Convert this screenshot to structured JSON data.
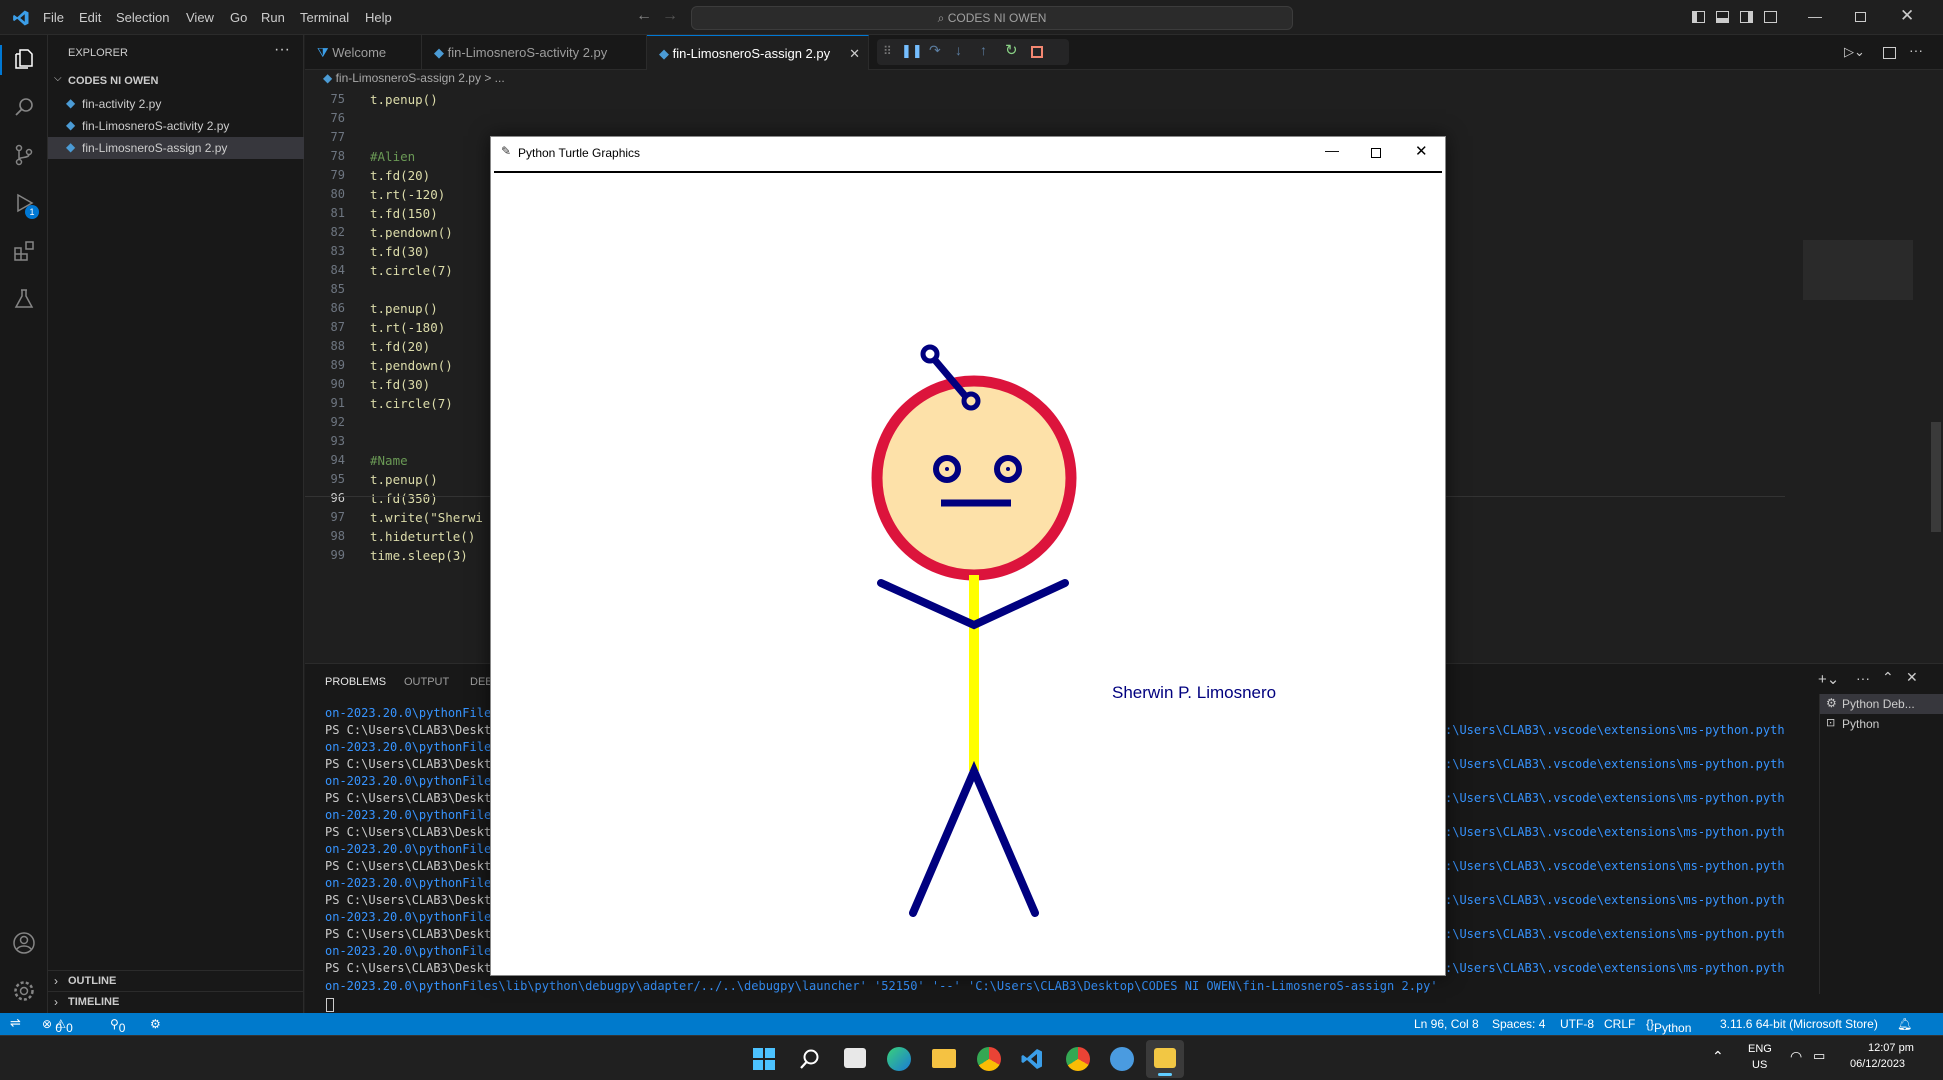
{
  "menu": [
    "File",
    "Edit",
    "Selection",
    "View",
    "Go",
    "Run",
    "Terminal",
    "Help"
  ],
  "command_center": "CODES NI OWEN",
  "explorer": {
    "title": "EXPLORER",
    "folder": "CODES NI OWEN",
    "files": [
      "fin-activity 2.py",
      "fin-LimosneroS-activity 2.py",
      "fin-LimosneroS-assign 2.py"
    ],
    "outline": "OUTLINE",
    "timeline": "TIMELINE"
  },
  "tabs": [
    "Welcome",
    "fin-LimosneroS-activity 2.py",
    "fin-LimosneroS-assign 2.py"
  ],
  "breadcrumb": "fin-LimosneroS-assign 2.py > ...",
  "code_lines": [
    {
      "n": "75",
      "t": "t.penup()"
    },
    {
      "n": "76",
      "t": ""
    },
    {
      "n": "77",
      "t": ""
    },
    {
      "n": "78",
      "t": "#Alien"
    },
    {
      "n": "79",
      "t": "t.fd(20)"
    },
    {
      "n": "80",
      "t": "t.rt(-120)"
    },
    {
      "n": "81",
      "t": "t.fd(150)"
    },
    {
      "n": "82",
      "t": "t.pendown()"
    },
    {
      "n": "83",
      "t": "t.fd(30)"
    },
    {
      "n": "84",
      "t": "t.circle(7)"
    },
    {
      "n": "85",
      "t": ""
    },
    {
      "n": "86",
      "t": "t.penup()"
    },
    {
      "n": "87",
      "t": "t.rt(-180)"
    },
    {
      "n": "88",
      "t": "t.fd(20)"
    },
    {
      "n": "89",
      "t": "t.pendown()"
    },
    {
      "n": "90",
      "t": "t.fd(30)"
    },
    {
      "n": "91",
      "t": "t.circle(7)"
    },
    {
      "n": "92",
      "t": ""
    },
    {
      "n": "93",
      "t": ""
    },
    {
      "n": "94",
      "t": "#Name"
    },
    {
      "n": "95",
      "t": "t.penup()"
    },
    {
      "n": "96",
      "t": "t.fd(350)"
    },
    {
      "n": "97",
      "t": "t.write(\"Sherwi"
    },
    {
      "n": "98",
      "t": "t.hideturtle()"
    },
    {
      "n": "99",
      "t": "time.sleep(3)"
    }
  ],
  "panel_tabs": [
    "PROBLEMS",
    "OUTPUT",
    "DEB"
  ],
  "terminal_left": [
    "on-2023.20.0\\pythonFile",
    "PS C:\\Users\\CLAB3\\Deskt",
    "on-2023.20.0\\pythonFile",
    "PS C:\\Users\\CLAB3\\Deskt",
    "on-2023.20.0\\pythonFile",
    "PS C:\\Users\\CLAB3\\Deskt",
    "on-2023.20.0\\pythonFile",
    "PS C:\\Users\\CLAB3\\Deskt",
    "on-2023.20.0\\pythonFile",
    "PS C:\\Users\\CLAB3\\Deskt",
    "on-2023.20.0\\pythonFile",
    "PS C:\\Users\\CLAB3\\Deskt",
    "on-2023.20.0\\pythonFile",
    "PS C:\\Users\\CLAB3\\Deskt",
    "on-2023.20.0\\pythonFile",
    "PS C:\\Users\\CLAB3\\Deskt"
  ],
  "terminal_right": ":\\Users\\CLAB3\\.vscode\\extensions\\ms-python.pyth",
  "terminal_last": "on-2023.20.0\\pythonFiles\\lib\\python\\debugpy\\adapter/../..\\debugpy\\launcher' '52150' '--' 'C:\\Users\\CLAB3\\Desktop\\CODES NI OWEN\\fin-LimosneroS-assign 2.py'",
  "terminal_list": [
    "Python Deb...",
    "Python"
  ],
  "turtle": {
    "window_title": "Python Turtle Graphics",
    "name_text": "Sherwin P. Limosnero"
  },
  "status": {
    "errors": "0",
    "warnings": "0",
    "ports": "0",
    "position": "Ln 96, Col 8",
    "spaces": "Spaces: 4",
    "encoding": "UTF-8",
    "eol": "CRLF",
    "language": "Python",
    "interpreter": "3.11.6 64-bit (Microsoft Store)"
  },
  "tray": {
    "lang1": "ENG",
    "lang2": "US",
    "time": "12:07 pm",
    "date": "06/12/2023"
  },
  "colors": {
    "accent": "#007acc",
    "head_fill": "#fde1a9",
    "head_outline": "#dc143c",
    "navy": "#00007f",
    "body": "#ffff00"
  }
}
